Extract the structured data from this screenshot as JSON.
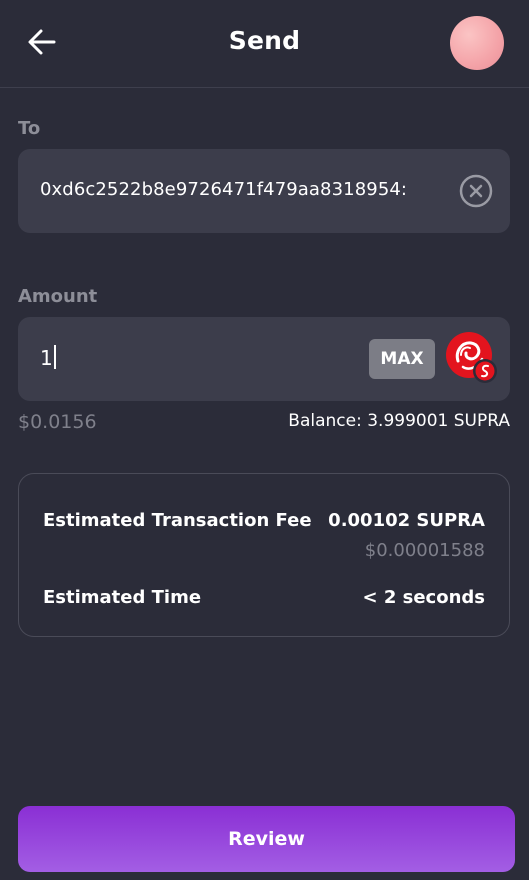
{
  "header": {
    "title": "Send",
    "back_icon": "arrow-left-icon",
    "avatar_colors": [
      "#fbc4c4",
      "#ea8f98"
    ]
  },
  "to_field": {
    "label": "To",
    "value": "0xd6c2522b8e9726471f479aa8318954:",
    "clear_icon": "clear-circle-icon"
  },
  "amount_field": {
    "label": "Amount",
    "value": "1",
    "max_label": "MAX",
    "token_icon": "supra-token-icon",
    "usd_value": "$0.0156",
    "balance": "Balance: 3.999001 SUPRA"
  },
  "fee_card": {
    "fee_label": "Estimated Transaction Fee",
    "fee_value": "0.00102 SUPRA",
    "fee_usd": "$0.00001588",
    "time_label": "Estimated Time",
    "time_value": "< 2 seconds"
  },
  "review_button": {
    "label": "Review"
  },
  "colors": {
    "background": "#2b2c39",
    "input_background": "#3c3d4b",
    "muted_text": "#8d8e98",
    "accent_gradient": [
      "#8a2fd4",
      "#a35ee4"
    ],
    "token_red": "#e3141e"
  }
}
